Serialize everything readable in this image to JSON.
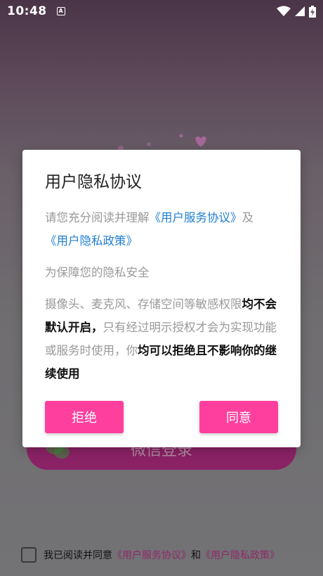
{
  "status_bar": {
    "time": "10:48",
    "a_icon_label": "A",
    "icons": [
      "a-notification-icon",
      "wifi-icon",
      "signal-icon",
      "battery-charging-icon"
    ]
  },
  "background": {
    "wechat_login_label": "微信登录",
    "wechat_icon": "wechat-icon"
  },
  "dialog": {
    "title": "用户隐私协议",
    "para1_prefix": "请您充分阅读并理解",
    "para1_link1": "《用户服务协议》",
    "para1_and": "及",
    "para1_link2": "《用户隐私政策》",
    "para2": "为保障您的隐私安全",
    "para3_normal1": "摄像头、麦克风、存储空间等敏感权限",
    "para3_bold1": "均不会默认开启，",
    "para3_normal2": "只有经过明示授权才会为实现功能或服务时使用，你",
    "para3_bold2": "均可以拒绝且不影响你的继续使用",
    "refuse_label": "拒绝",
    "agree_label": "同意"
  },
  "bottom": {
    "prefix": "我已阅读并同意",
    "link1": "《用户服务协议》",
    "and": "和",
    "link2": "《用户隐私政策》"
  },
  "colors": {
    "accent_pink": "#ff3f9e",
    "link_blue": "#1f7fd0",
    "dialog_bg": "#ffffff",
    "wechat_button_bg": "#8b2266"
  }
}
